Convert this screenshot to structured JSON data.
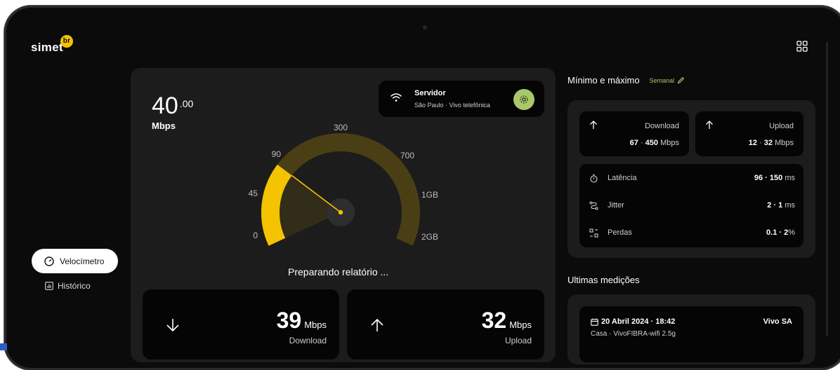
{
  "app": {
    "logo_text": "simet",
    "logo_badge": "br"
  },
  "nav": {
    "speedometer_label": "Velocímetro",
    "history_label": "Histórico"
  },
  "speed": {
    "value": "40",
    "decimals": ".00",
    "unit": "Mbps"
  },
  "server": {
    "title": "Servidor",
    "subtitle": "São Paulo · Vivo telefônica"
  },
  "gauge": {
    "ticks": [
      "0",
      "45",
      "90",
      "300",
      "700",
      "1GB",
      "2GB"
    ],
    "fill_fraction": 0.27,
    "color_fill": "#f5c400",
    "color_track": "#4a3f14"
  },
  "status_text": "Preparando relatório ...",
  "download_card": {
    "value": "39",
    "unit": "Mbps",
    "label": "Download"
  },
  "upload_card": {
    "value": "32",
    "unit": "Mbps",
    "label": "Upload"
  },
  "minmax": {
    "title": "Mínimo e máximo",
    "period": "Semanal",
    "download": {
      "label": "Download",
      "min": "67",
      "max": "450",
      "unit": "Mbps"
    },
    "upload": {
      "label": "Upload",
      "min": "12",
      "max": "32",
      "unit": "Mbps"
    },
    "latency": {
      "label": "Latência",
      "range": "96 · 150",
      "unit": "ms"
    },
    "jitter": {
      "label": "Jitter",
      "range": "2 · 1",
      "unit": "ms"
    },
    "loss": {
      "label": "Perdas",
      "range": "0.1 · 2",
      "unit": "%"
    }
  },
  "recent": {
    "title": "Ultimas medições",
    "items": [
      {
        "date": "20 Abril 2024 · 18:42",
        "operator": "Vivo SA",
        "location": "Casa · VivoFIBRA-wifi 2.5g"
      }
    ]
  },
  "colors": {
    "accent_yellow": "#f5c400",
    "accent_green": "#a9c86a",
    "card_bg": "#1c1c1c"
  }
}
